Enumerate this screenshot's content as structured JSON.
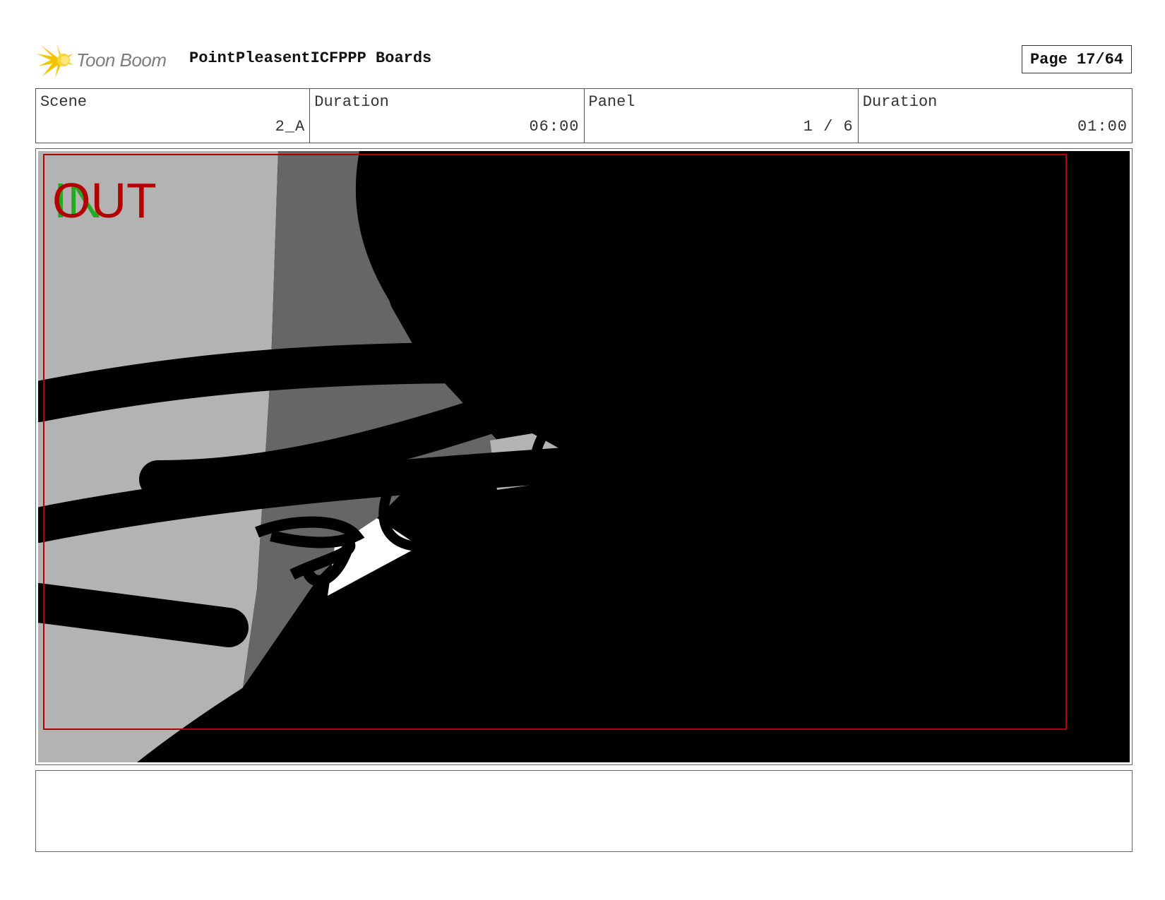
{
  "header": {
    "logo_text": "Toon Boom",
    "board_title": "PointPleasentICFPPP Boards",
    "page_label": "Page 17/64"
  },
  "info": {
    "scene_label": "Scene",
    "scene_value": "2_A",
    "scene_duration_label": "Duration",
    "scene_duration_value": "06:00",
    "panel_label": "Panel",
    "panel_value": "1 / 6",
    "panel_duration_label": "Duration",
    "panel_duration_value": "01:00"
  },
  "panel": {
    "in_marker": "IN",
    "out_marker": "OUT",
    "colors": {
      "in": "#22aa22",
      "out": "#b30000",
      "safe_frame": "#b30000",
      "light_gray": "#b3b3b3",
      "mid_gray": "#666666",
      "black": "#000000"
    }
  },
  "notes": {
    "text": ""
  }
}
